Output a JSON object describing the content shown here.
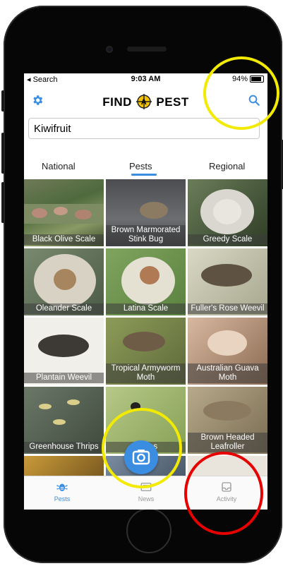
{
  "status": {
    "left": "◂ Search",
    "time": "9:03 AM",
    "battery": "94%"
  },
  "nav": {
    "brand_left": "FIND",
    "brand_mid": "A",
    "brand_right": "PEST"
  },
  "search_field": {
    "value": "Kiwifruit"
  },
  "tabs": [
    {
      "label": "National"
    },
    {
      "label": "Pests"
    },
    {
      "label": "Regional"
    }
  ],
  "tiles": [
    {
      "label": "Black Olive Scale"
    },
    {
      "label": "Brown Marmorated Stink Bug"
    },
    {
      "label": "Greedy Scale"
    },
    {
      "label": "Oleander Scale"
    },
    {
      "label": "Latina Scale"
    },
    {
      "label": "Fuller's Rose Weevil"
    },
    {
      "label": "Plantain Weevil"
    },
    {
      "label": "Tropical Armyworm Moth"
    },
    {
      "label": "Australian Guava Moth"
    },
    {
      "label": "Greenhouse Thrips"
    },
    {
      "label": "N... ps"
    },
    {
      "label": "Brown Headed Leafroller"
    }
  ],
  "tabbar": [
    {
      "label": "Pests"
    },
    {
      "label": "News"
    },
    {
      "label": "Activity"
    }
  ],
  "colors": {
    "accent": "#3b8de1",
    "yellow_ring": "#f2ea00",
    "red_ring": "#e60000"
  },
  "icons": [
    "gear-icon",
    "search-icon",
    "camera-icon",
    "bug-icon",
    "news-icon",
    "inbox-icon"
  ]
}
